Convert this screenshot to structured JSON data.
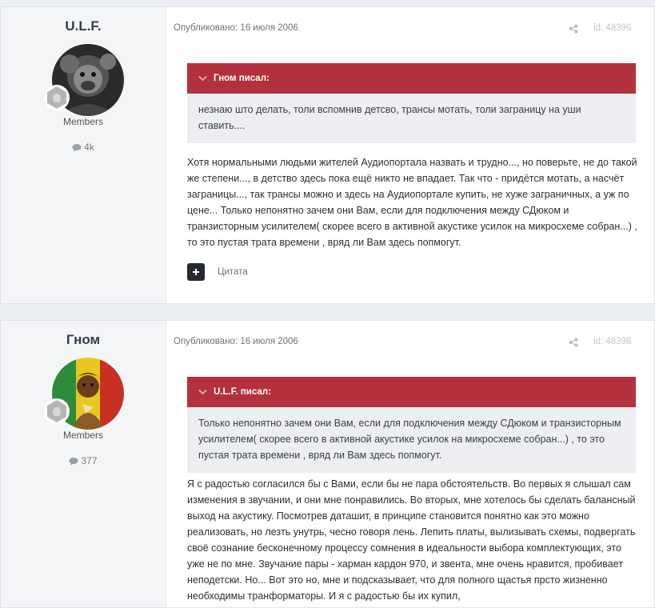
{
  "posts": [
    {
      "author": "U.L.F.",
      "group": "Members",
      "post_count": "4k",
      "published": "Опубликовано: 16 июля 2006",
      "post_id": "id: 48396",
      "quote": {
        "header": "Гном писал:",
        "text": "незнаю што делать, толи вспомнив детсво, трансы мотать, толи заграницу на уши ставить...."
      },
      "content": "Хотя нормальными людьми жителей Аудиопортала назвать и трудно..., но поверьте, не до такой же степени..., в детство здесь пока ещё никто не впадает. Так что - придётся мотать, а насчёт заграницы..., так трансы можно и здесь на Аудиопортале купить, не хуже заграничных, а уж по цене... Только непонятно зачем они Вам, если для подключения между СДюком и транзисторным усилителем( скорее всего в активной акустике усилок на микросхеме собран...) , то это пустая трата времени , вряд ли Вам здесь попмогут.",
      "cite_label": "Цитата"
    },
    {
      "author": "Гном",
      "group": "Members",
      "post_count": "377",
      "published": "Опубликовано: 16 июля 2006",
      "post_id": "id: 48398",
      "quote": {
        "header": "U.L.F. писал:",
        "text": "Только непонятно зачем они Вам, если для подключения между СДюком и транзисторным усилителем( скорее всего в активной акустике усилок на микросхеме собран...) , то это пустая трата времени , вряд ли Вам здесь попмогут."
      },
      "content": "Я с радостью согласился бы с Вами, если бы не пара обстоятельств. Во первых я слышал сам изменения в звучании, и они мне понравились. Во вторых, мне хотелось бы сделать балансный выход на акустику. Посмотрев даташит, в принципе становится понятно как это можно реализовать, но лезть унутрь, чесно говоря лень. Лепить платы, вылизывать схемы, подвергать своё сознание бесконечному процессу сомнения в идеальности выбора комплектующих, это уже не по мне. Звучание пары - харман кардон 970, и звента, мне очень нравится, пробивает неподетски. Но... Вот это но, мне и подсказывает, что для полного щастья прсто жизненно необходимы транформаторы. И я с радостью бы их купил,"
    }
  ],
  "colors": {
    "quote_header": "#b2313c",
    "quote_body": "#eceef2",
    "author_panel": "#f4f5f7"
  },
  "icons": [
    "chevron-down-icon",
    "share-icon",
    "comment-icon",
    "rank-badge-icon",
    "plus-icon"
  ]
}
